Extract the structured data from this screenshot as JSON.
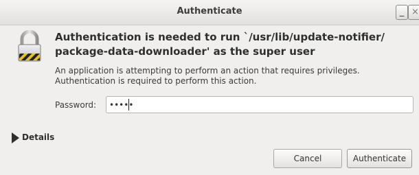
{
  "window": {
    "title": "Authenticate",
    "minimize_glyph": "_",
    "close_glyph": "×"
  },
  "dialog": {
    "icon": "lock-icon",
    "heading": "Authentication is needed to run `/usr/lib/update-notifier/ package-data-downloader' as the super user",
    "description": "An application is attempting to perform an action that requires privileges. Authentication is required to perform this action.",
    "password_label": "Password:",
    "password_value": "•••••",
    "details_label": "Details",
    "cancel_label": "Cancel",
    "authenticate_label": "Authenticate"
  },
  "colors": {
    "background": "#f0efee",
    "text": "#2e2e2e",
    "lock_stripe_yellow": "#e8c21c"
  }
}
